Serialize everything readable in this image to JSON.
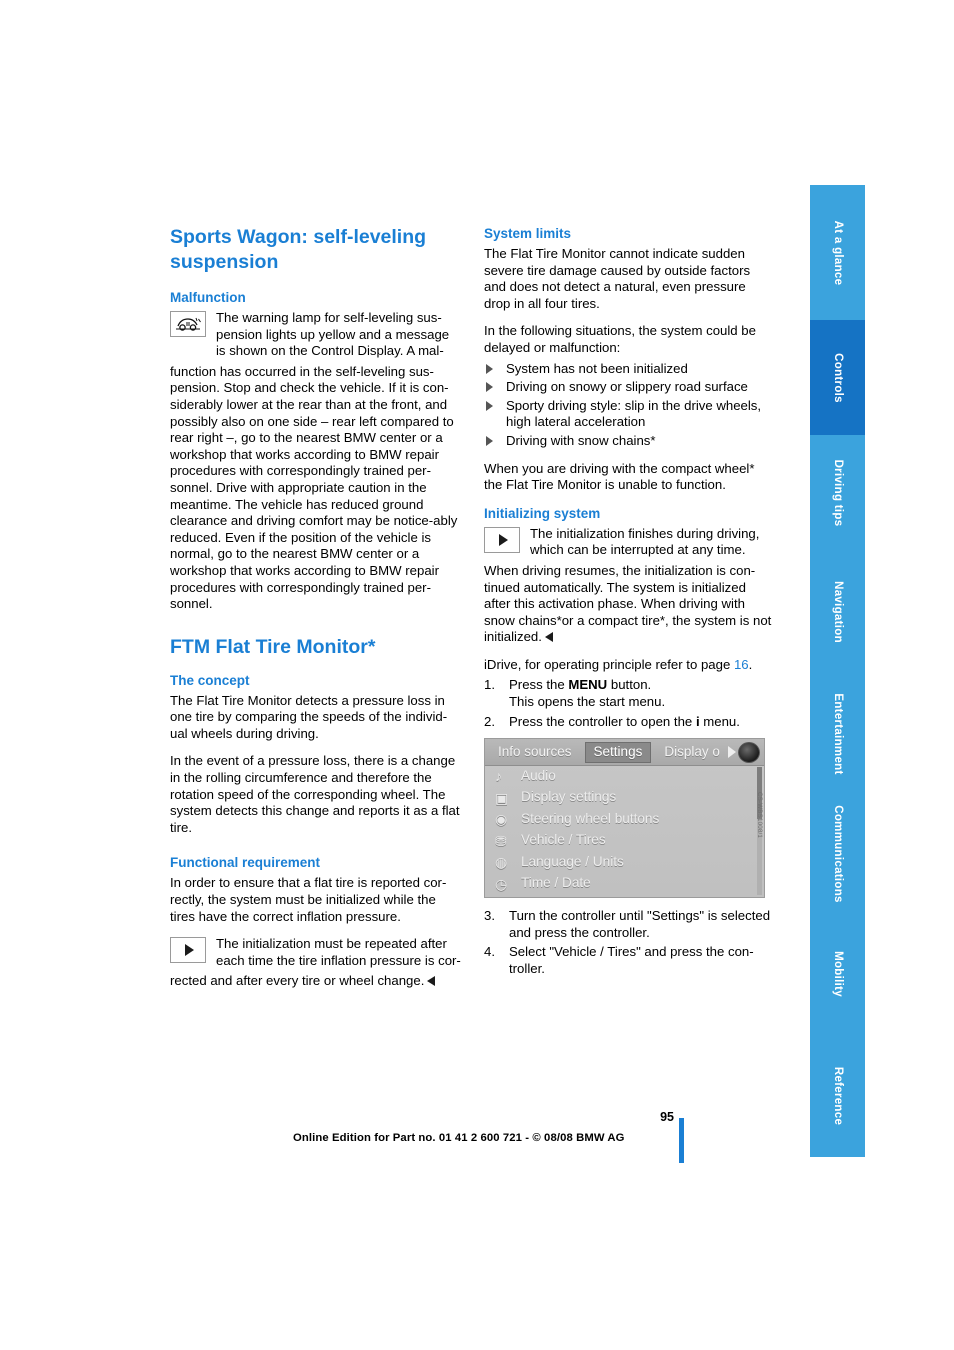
{
  "document": {
    "page_number": "95",
    "footer": "Online Edition for Part no. 01 41 2 600 721 - © 08/08 BMW AG",
    "image_code": "CS-WBS1008/1"
  },
  "side_tabs": [
    {
      "label": "At a glance"
    },
    {
      "label": "Controls"
    },
    {
      "label": "Driving tips"
    },
    {
      "label": "Navigation"
    },
    {
      "label": "Entertainment"
    },
    {
      "label": "Communications"
    },
    {
      "label": "Mobility"
    },
    {
      "label": "Reference"
    }
  ],
  "left_column": {
    "title": "Sports Wagon: self-leveling suspension",
    "malfunction": {
      "heading": "Malfunction",
      "note": "The warning lamp for self-leveling sus-pension lights up yellow and a message is shown on the Control Display. A mal-",
      "body": "function has occurred in the self-leveling sus-pension. Stop and check the vehicle. If it is con-siderably lower at the rear than at the front, and possibly also on one side – rear left compared to rear right –, go to the nearest BMW center or a workshop that works according to BMW repair procedures with correspondingly trained per-sonnel. Drive with appropriate caution in the meantime. The vehicle has reduced ground clearance and driving comfort may be notice-ably reduced. Even if the position of the vehicle is normal, go to the nearest BMW center or a workshop that works according to BMW repair procedures with correspondingly trained per-sonnel."
    },
    "ftm": {
      "title": "FTM Flat Tire Monitor*",
      "concept_heading": "The concept",
      "concept_p1": "The Flat Tire Monitor detects a pressure loss in one tire by comparing the speeds of the individ-ual wheels during driving.",
      "concept_p2": "In the event of a pressure loss, there is a change in the rolling circumference and therefore the rotation speed of the corresponding wheel. The system detects this change and reports it as a flat tire.",
      "requirement_heading": "Functional requirement",
      "requirement_p1": "In order to ensure that a flat tire is reported cor-rectly, the system must be initialized while the tires have the correct inflation pressure.",
      "requirement_note": "The initialization must be repeated after each time the tire inflation pressure is cor-",
      "requirement_note_rest": "rected and after every tire or wheel change."
    }
  },
  "right_column": {
    "system_limits": {
      "heading": "System limits",
      "p1": "The Flat Tire Monitor cannot indicate sudden severe tire damage caused by outside factors and does not detect a natural, even pressure drop in all four tires.",
      "p2": "In the following situations, the system could be delayed or malfunction:",
      "bullets": [
        "System has not been initialized",
        "Driving on snowy or slippery road surface",
        "Sporty driving style: slip in the drive wheels, high lateral acceleration",
        "Driving with snow chains*"
      ],
      "p3": "When you are driving with the compact wheel* the Flat Tire Monitor is unable to function."
    },
    "initializing": {
      "heading": "Initializing system",
      "note": "The initialization finishes during driving, which can be interrupted at any time.",
      "body": "When driving resumes, the initialization is con-tinued automatically. The system is initialized after this activation phase. When driving with snow chains*or a compact tire*, the system is not initialized.",
      "idrive_line_pre": "iDrive, for operating principle refer to page ",
      "idrive_link": "16",
      "idrive_line_post": ".",
      "steps": [
        {
          "num": "1.",
          "text_pre": "Press the ",
          "bold": "MENU",
          "text_post": " button.",
          "sub": "This opens the start menu."
        },
        {
          "num": "2.",
          "text_pre": "Press the controller to open the ",
          "bold": "i",
          "text_post": " menu.",
          "sub": ""
        },
        {
          "num": "3.",
          "text_pre": "Turn the controller until \"Settings\" is selected and press the controller.",
          "bold": "",
          "text_post": "",
          "sub": ""
        },
        {
          "num": "4.",
          "text_pre": "Select \"Vehicle / Tires\" and press the con-troller.",
          "bold": "",
          "text_post": "",
          "sub": ""
        }
      ]
    },
    "idrive_screen": {
      "tabs": [
        {
          "label": "Info sources",
          "active": false
        },
        {
          "label": "Settings",
          "active": true
        },
        {
          "label": "Display o",
          "active": false
        }
      ],
      "menu_items": [
        {
          "label": "Audio",
          "icon": "note-icon"
        },
        {
          "label": "Display settings",
          "icon": "display-icon"
        },
        {
          "label": "Steering wheel buttons",
          "icon": "steering-icon"
        },
        {
          "label": "Vehicle / Tires",
          "icon": "car-icon"
        },
        {
          "label": "Language / Units",
          "icon": "globe-icon"
        },
        {
          "label": "Time / Date",
          "icon": "clock-icon"
        }
      ]
    }
  }
}
